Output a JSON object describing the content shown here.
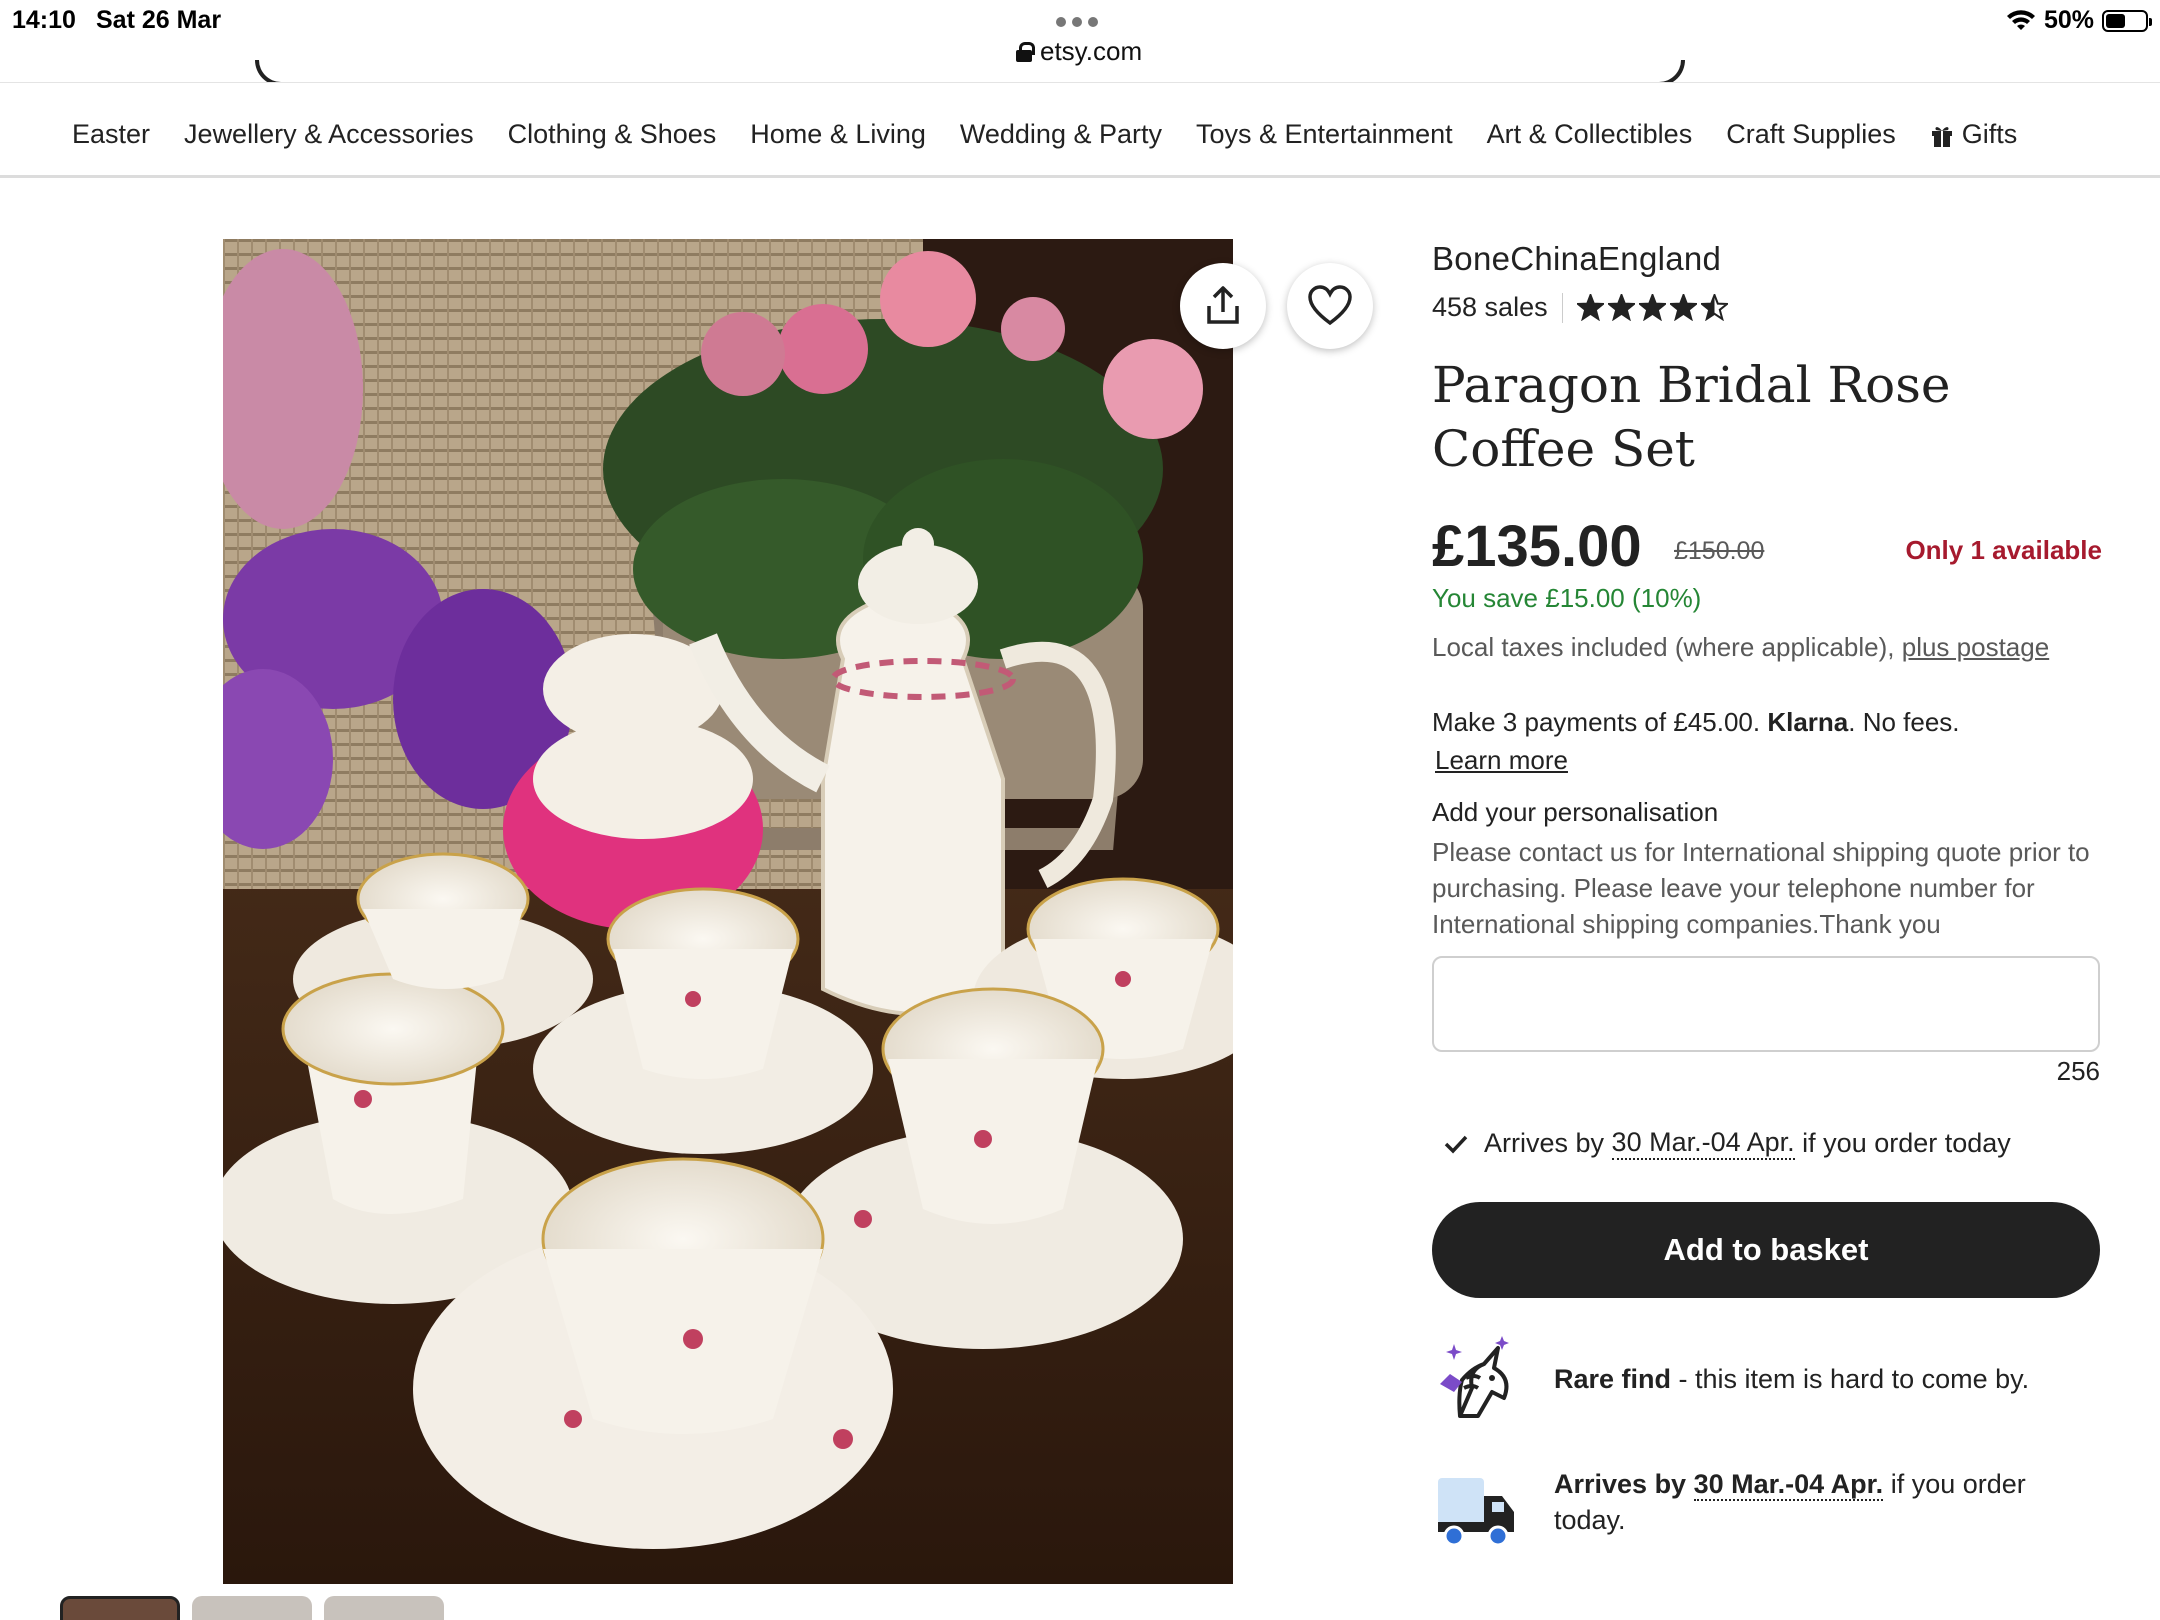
{
  "status_bar": {
    "time": "14:10",
    "date": "Sat 26 Mar",
    "url": "etsy.com",
    "battery": "50%",
    "battery_level": 0.5
  },
  "nav": {
    "categories": [
      "Easter",
      "Jewellery & Accessories",
      "Clothing & Shoes",
      "Home & Living",
      "Wedding & Party",
      "Toys & Entertainment",
      "Art & Collectibles",
      "Craft Supplies",
      "Gifts"
    ]
  },
  "gallery": {
    "icons": [
      "share-icon",
      "heart-icon"
    ],
    "thumbnail_count": 3
  },
  "product": {
    "shop_name": "BoneChinaEngland",
    "sales": "458 sales",
    "rating": 4.5,
    "title": "Paragon Bridal Rose Coffee Set",
    "price": "£135.00",
    "original_price": "£150.00",
    "stock": "Only 1 available",
    "savings": "You save £15.00 (10%)",
    "tax_note": "Local taxes included (where applicable),",
    "postage_link": "plus postage",
    "klarna_text": "Make 3 payments of £45.00.",
    "klarna_brand": "Klarna",
    "klarna_suffix": ". No fees.",
    "learn_more": "Learn more",
    "personalisation_label": "Add your personalisation",
    "personalisation_help": "Please contact us for International shipping quote prior to purchasing. Please leave your telephone number for International shipping companies.Thank you",
    "personalisation_value": "",
    "char_count": "256",
    "arrives_prefix": "Arrives by",
    "arrives_dates": "30 Mar.-04 Apr.",
    "arrives_suffix": "if you order today",
    "add_to_basket": "Add to basket",
    "rare_bold": "Rare find",
    "rare_text": " - this item is hard to come by.",
    "ship_bold_prefix": "Arrives by",
    "ship_bold_dates": "30 Mar.-04 Apr.",
    "ship_text": " if you order today."
  },
  "colors": {
    "stock_red": "#a61a2e",
    "save_green": "#258635",
    "button_bg": "#222222"
  }
}
